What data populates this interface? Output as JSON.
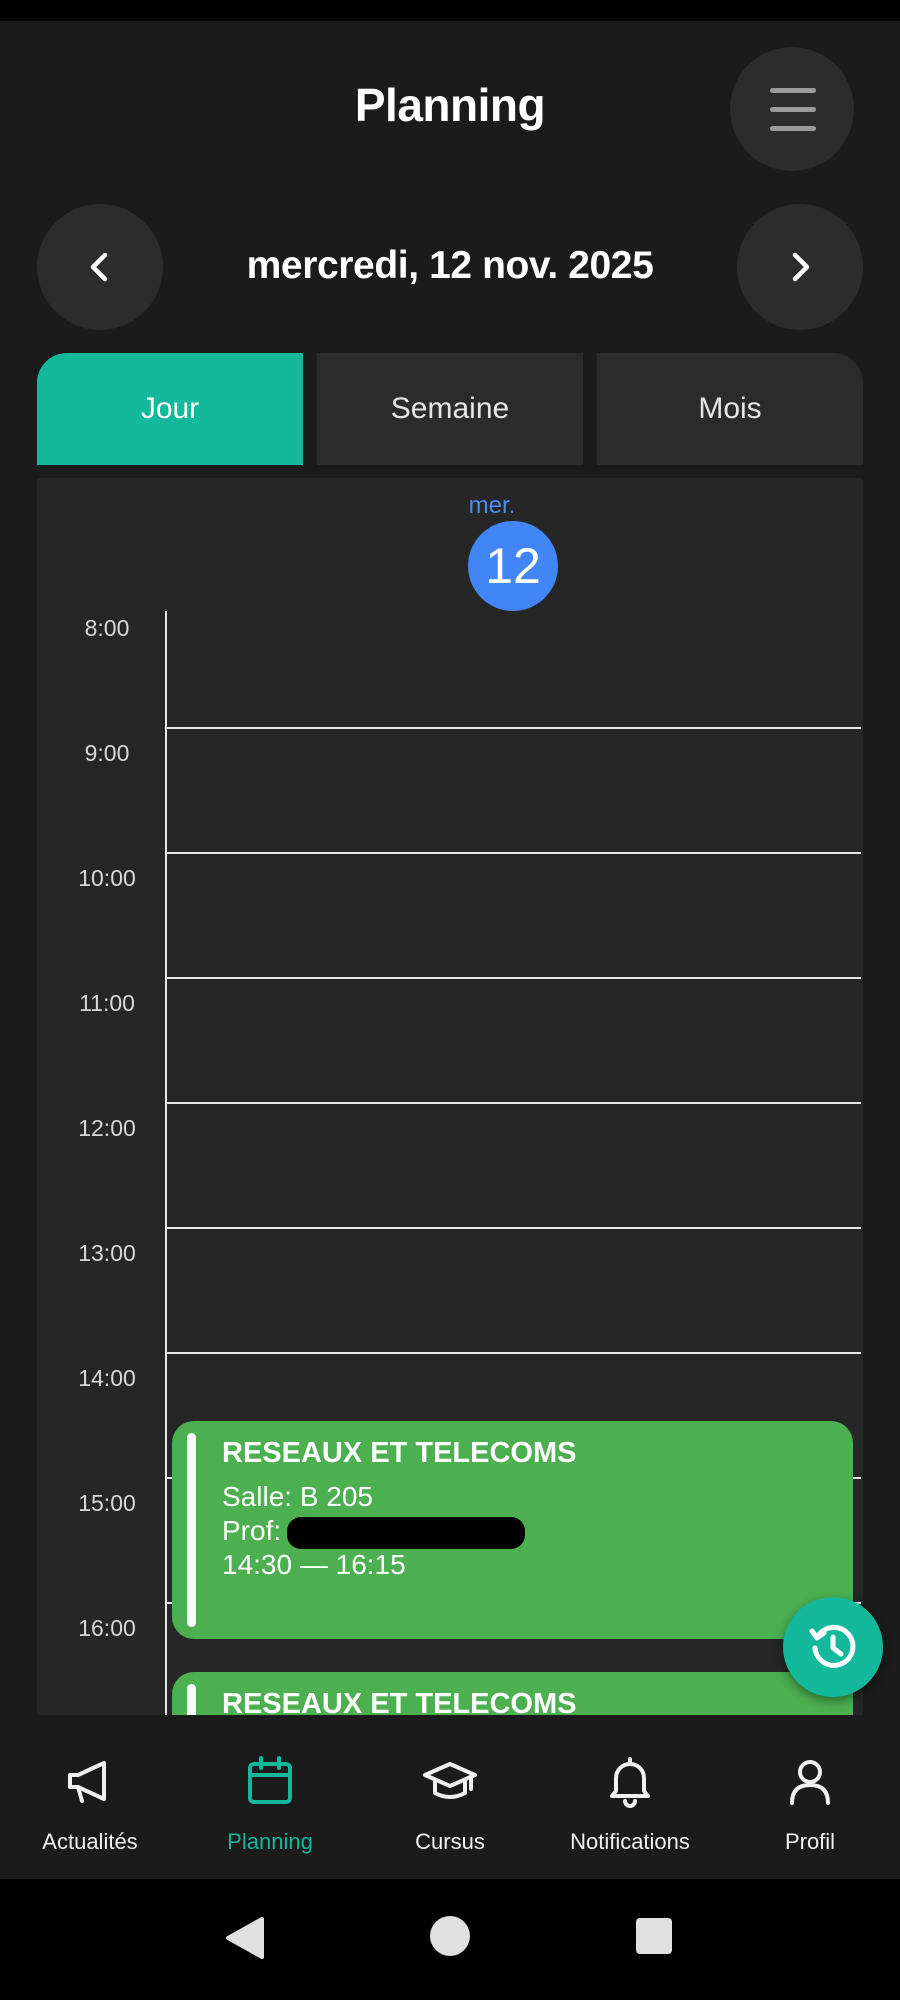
{
  "header": {
    "title": "Planning",
    "menu_icon": "hamburger-menu-icon"
  },
  "date_nav": {
    "label": "mercredi, 12 nov. 2025",
    "prev_icon": "chevron-left-icon",
    "next_icon": "chevron-right-icon"
  },
  "tabs": [
    {
      "label": "Jour",
      "active": true
    },
    {
      "label": "Semaine",
      "active": false
    },
    {
      "label": "Mois",
      "active": false
    }
  ],
  "day_header": {
    "abbr": "mer.",
    "number": "12"
  },
  "hours": [
    "8:00",
    "9:00",
    "10:00",
    "11:00",
    "12:00",
    "13:00",
    "14:00",
    "15:00",
    "16:00"
  ],
  "events": [
    {
      "title": "RESEAUX ET TELECOMS",
      "room": "Salle: B 205",
      "prof_label": "Prof:",
      "time": "14:30 — 16:15"
    },
    {
      "title": "RESEAUX ET TELECOMS"
    }
  ],
  "fab": {
    "icon": "history-icon"
  },
  "bottom_nav": [
    {
      "label": "Actualités",
      "icon": "megaphone-icon",
      "active": false
    },
    {
      "label": "Planning",
      "icon": "calendar-icon",
      "active": true
    },
    {
      "label": "Cursus",
      "icon": "graduation-cap-icon",
      "active": false
    },
    {
      "label": "Notifications",
      "icon": "bell-icon",
      "active": false
    },
    {
      "label": "Profil",
      "icon": "user-icon",
      "active": false
    }
  ],
  "system_nav": {
    "back_icon": "back-triangle-icon",
    "home_icon": "home-circle-icon",
    "recents_icon": "recents-square-icon"
  },
  "colors": {
    "accent": "#14b89b",
    "event": "#4caf50",
    "today": "#4285f4",
    "background": "#1b1b1b"
  }
}
